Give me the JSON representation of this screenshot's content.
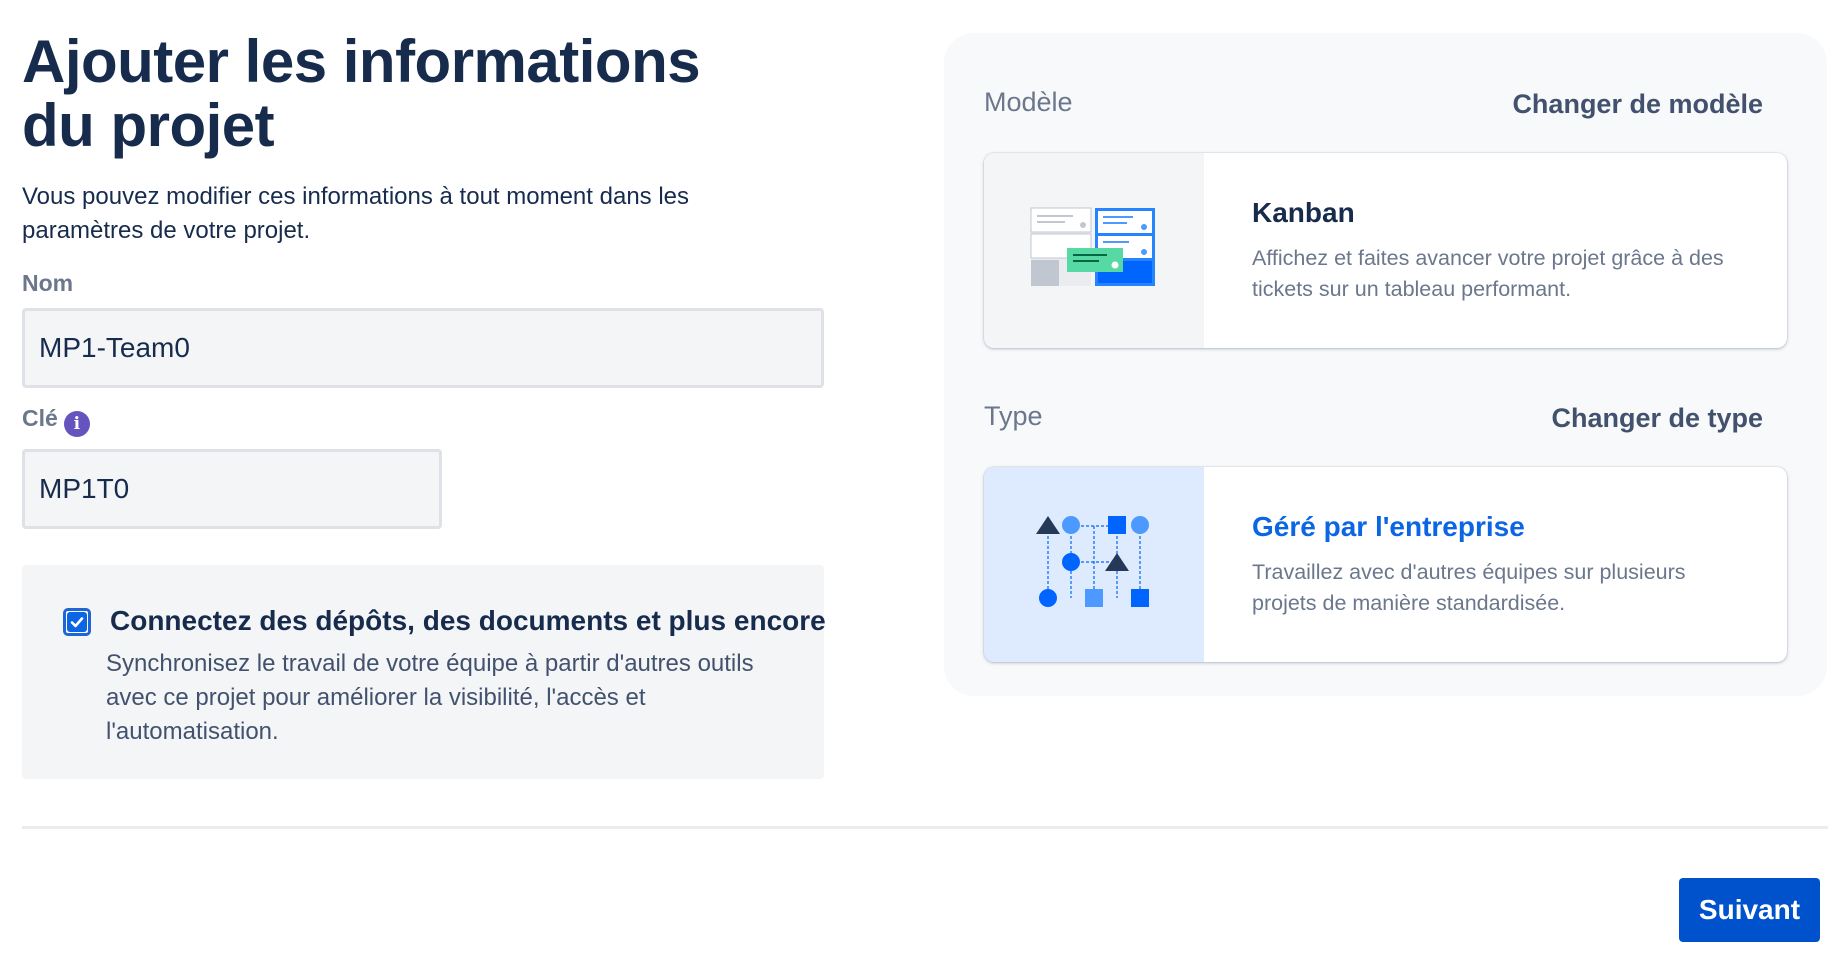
{
  "page": {
    "title": "Ajouter les informations du projet",
    "subtitle": "Vous pouvez modifier ces informations à tout moment dans les paramètres de votre projet."
  },
  "form": {
    "name_label": "Nom",
    "name_value": "MP1-Team0",
    "key_label": "Clé",
    "key_info_icon": "i",
    "key_value": "MP1T0"
  },
  "connect": {
    "checked": true,
    "title": "Connectez des dépôts, des documents et plus encore",
    "description": "Synchronisez le travail de votre équipe à partir d'autres outils avec ce projet pour améliorer la visibilité, l'accès et l'automatisation."
  },
  "template": {
    "section_label": "Modèle",
    "change_label": "Changer de modèle",
    "card_title": "Kanban",
    "card_description": "Affichez et faites avancer votre projet grâce à des tickets sur un tableau performant.",
    "icon": "kanban-illustration-icon"
  },
  "type": {
    "section_label": "Type",
    "change_label": "Changer de type",
    "card_title": "Géré par l'entreprise",
    "card_description": "Travaillez avec d'autres équipes sur plusieurs projets de manière standardisée.",
    "icon": "company-managed-illustration-icon"
  },
  "footer": {
    "next_label": "Suivant"
  },
  "colors": {
    "primary": "#0052cc",
    "heading": "#172b4d",
    "link_title": "#0c66e4",
    "type_media_bg": "#deebff",
    "template_media_bg": "#f4f5f7"
  }
}
